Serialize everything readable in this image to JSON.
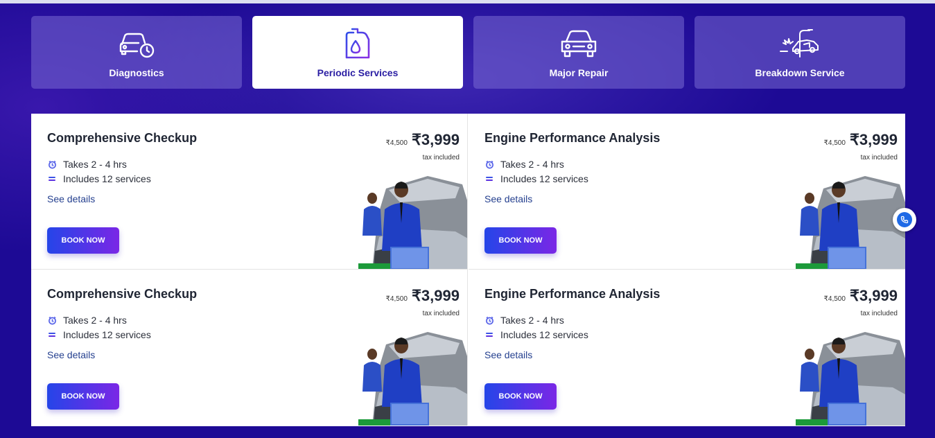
{
  "tabs": [
    {
      "label": "Diagnostics",
      "icon": "car-clock-icon",
      "active": false
    },
    {
      "label": "Periodic Services",
      "icon": "oil-can-icon",
      "active": true
    },
    {
      "label": "Major Repair",
      "icon": "car-front-icon",
      "active": false
    },
    {
      "label": "Breakdown Service",
      "icon": "car-crash-icon",
      "active": false
    }
  ],
  "cards": [
    {
      "title": "Comprehensive Checkup",
      "old_price": "₹4,500",
      "price": "₹3,999",
      "tax": "tax included",
      "duration": "Takes 2 - 4 hrs",
      "services": "Includes 12 services",
      "details_label": "See details",
      "button_label": "BOOK NOW"
    },
    {
      "title": "Engine Performance Analysis",
      "old_price": "₹4,500",
      "price": "₹3,999",
      "tax": "tax included",
      "duration": "Takes 2 - 4 hrs",
      "services": "Includes 12 services",
      "details_label": "See details",
      "button_label": "BOOK NOW"
    },
    {
      "title": "Comprehensive Checkup",
      "old_price": "₹4,500",
      "price": "₹3,999",
      "tax": "tax included",
      "duration": "Takes 2 - 4 hrs",
      "services": "Includes 12 services",
      "details_label": "See details",
      "button_label": "BOOK NOW"
    },
    {
      "title": "Engine Performance Analysis",
      "old_price": "₹4,500",
      "price": "₹3,999",
      "tax": "tax included",
      "duration": "Takes 2 - 4 hrs",
      "services": "Includes 12 services",
      "details_label": "See details",
      "button_label": "BOOK NOW"
    }
  ],
  "floating": {
    "icon": "phone-icon"
  },
  "colors": {
    "background": "#1d0a95",
    "tab_inactive": "#7869d2",
    "tab_active_text": "#2a1ea3",
    "button_gradient_start": "#2545e8",
    "button_gradient_end": "#7a27e6",
    "link": "#25408f"
  }
}
